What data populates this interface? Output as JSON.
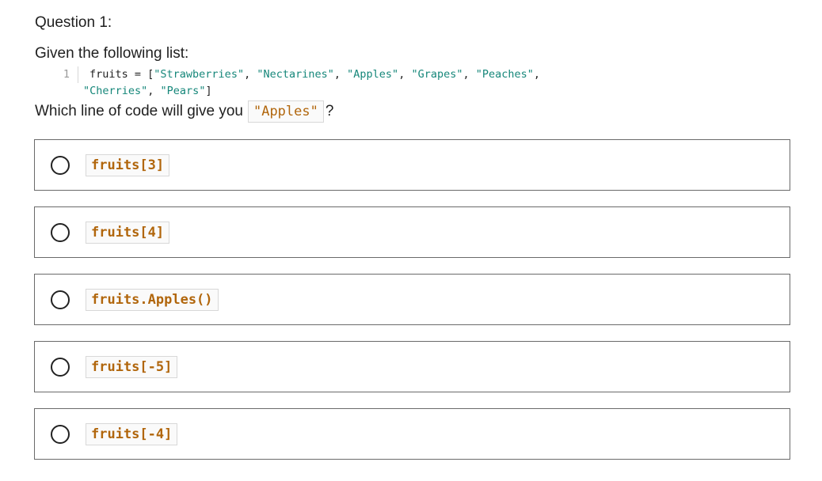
{
  "question": {
    "title": "Question 1:",
    "intro": "Given the following list:",
    "code": {
      "line_number": "1",
      "prefix": "fruits = [",
      "strings_line1": [
        "\"Strawberries\"",
        "\"Nectarines\"",
        "\"Apples\"",
        "\"Grapes\"",
        "\"Peaches\""
      ],
      "strings_line2": [
        "\"Cherries\"",
        "\"Pears\""
      ],
      "suffix": "]"
    },
    "prompt_before": "Which line of code will give you",
    "prompt_code": "\"Apples\"",
    "prompt_after": "?"
  },
  "options": [
    {
      "label": "fruits[3]"
    },
    {
      "label": "fruits[4]"
    },
    {
      "label": "fruits.Apples()"
    },
    {
      "label": "fruits[-5]"
    },
    {
      "label": "fruits[-4]"
    }
  ],
  "colors": {
    "code_string": "#16877a",
    "inline_code": "#b1660c",
    "border": "#6a6a6a"
  }
}
